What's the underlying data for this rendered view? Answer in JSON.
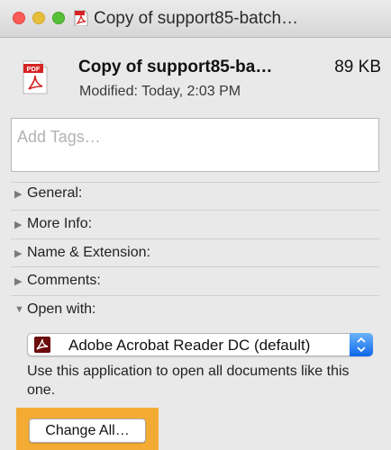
{
  "window": {
    "title": "Copy of support85-batch…",
    "controls": {
      "close": "close-icon",
      "minimize": "minimize-icon",
      "zoom": "zoom-icon"
    },
    "title_icon": "pdf-document-icon"
  },
  "file": {
    "icon": "pdf-document-icon",
    "icon_badge": "PDF",
    "name": "Copy of support85-ba…",
    "size": "89 KB",
    "modified": "Modified: Today, 2:03 PM"
  },
  "tags": {
    "placeholder": "Add Tags…",
    "value": ""
  },
  "sections": [
    {
      "label": "General:",
      "expanded": false
    },
    {
      "label": "More Info:",
      "expanded": false
    },
    {
      "label": "Name & Extension:",
      "expanded": false
    },
    {
      "label": "Comments:",
      "expanded": false
    },
    {
      "label": "Open with:",
      "expanded": true
    }
  ],
  "open_with": {
    "app": "Adobe Acrobat Reader DC (default)",
    "app_icon": "acrobat-reader-icon",
    "hint": "Use this application to open all documents like this one.",
    "change_all": "Change All…"
  },
  "colors": {
    "highlight": "#f4ab34",
    "close": "#fc5b57",
    "minimize": "#e5bf3c",
    "zoom": "#57c038",
    "pdf_red": "#d52222",
    "popup_accent": "#1a74ee"
  }
}
